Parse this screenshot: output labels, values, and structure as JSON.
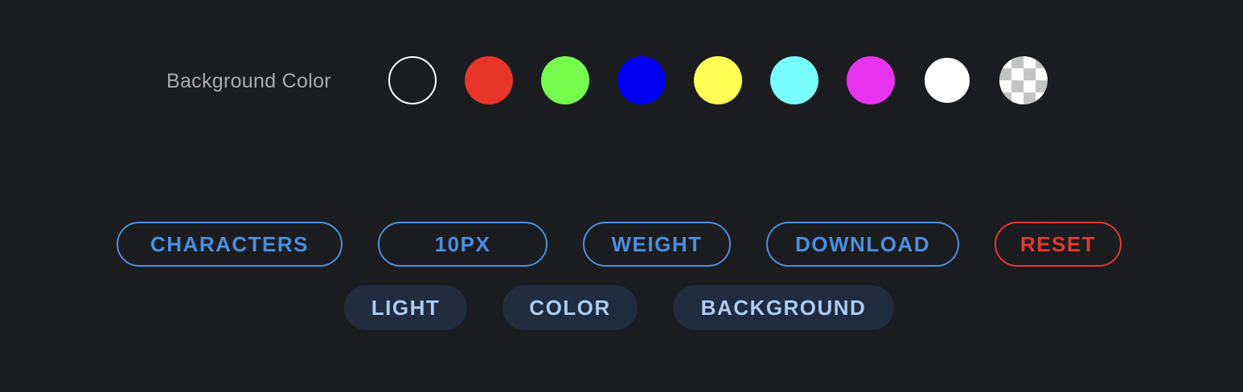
{
  "background_color": {
    "label": "Background Color",
    "swatches": [
      {
        "name": "black",
        "color": "#1b1c20",
        "selected": true
      },
      {
        "name": "red",
        "color": "#e8352a"
      },
      {
        "name": "green",
        "color": "#76fb4c"
      },
      {
        "name": "blue",
        "color": "#0000f5"
      },
      {
        "name": "yellow",
        "color": "#fefe55"
      },
      {
        "name": "cyan",
        "color": "#78fcfd"
      },
      {
        "name": "magenta",
        "color": "#e834f0"
      },
      {
        "name": "white",
        "color": "#ffffff"
      },
      {
        "name": "transparent",
        "color": "transparent"
      }
    ]
  },
  "controls": {
    "characters_label": "CHARACTERS",
    "size_label": "10PX",
    "weight_label": "WEIGHT",
    "download_label": "DOWNLOAD",
    "reset_label": "RESET",
    "light_label": "LIGHT",
    "color_label": "COLOR",
    "background_label": "BACKGROUND"
  },
  "colors": {
    "page_background": "#1b1c20",
    "accent_blue": "#4a8fe0",
    "danger_red": "#e03a2c",
    "filled_button_bg": "#202b3e",
    "filled_button_text": "#a9cdf2"
  }
}
